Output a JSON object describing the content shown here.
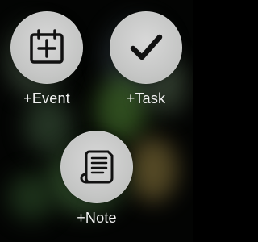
{
  "actions": {
    "event": {
      "label": "+Event",
      "icon": "calendar-plus-icon"
    },
    "task": {
      "label": "+Task",
      "icon": "checkmark-icon"
    },
    "note": {
      "label": "+Note",
      "icon": "note-scroll-icon"
    }
  },
  "colors": {
    "button_fill": "#c6c7c5",
    "icon": "#111111",
    "label": "#f1f1f1",
    "background": "#030403"
  }
}
